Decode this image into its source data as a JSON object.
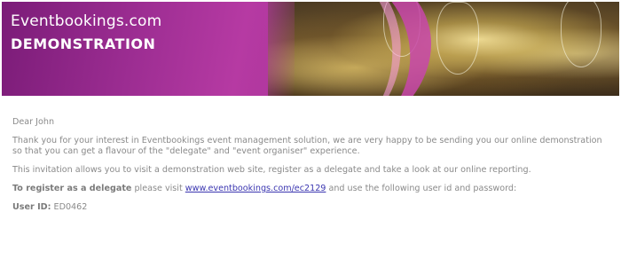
{
  "banner": {
    "brand": "Eventbookings.com",
    "subtitle": "DEMONSTRATION"
  },
  "email": {
    "greeting": "Dear John",
    "para1": "Thank you for your interest in Eventbookings event management solution, we are very happy to be sending you our online demonstration so that you can get a flavour of the \"delegate\" and \"event organiser\" experience.",
    "para2": "This invitation allows you to visit a demonstration web site, register as a delegate and take a look at our online reporting.",
    "register_lead": "To register as a delegate",
    "register_mid": " please visit ",
    "register_link": "www.eventbookings.com/ec2129",
    "register_tail": " and use the following user id and password:",
    "user_id_label": "User ID:",
    "user_id_value": " ED0462"
  }
}
